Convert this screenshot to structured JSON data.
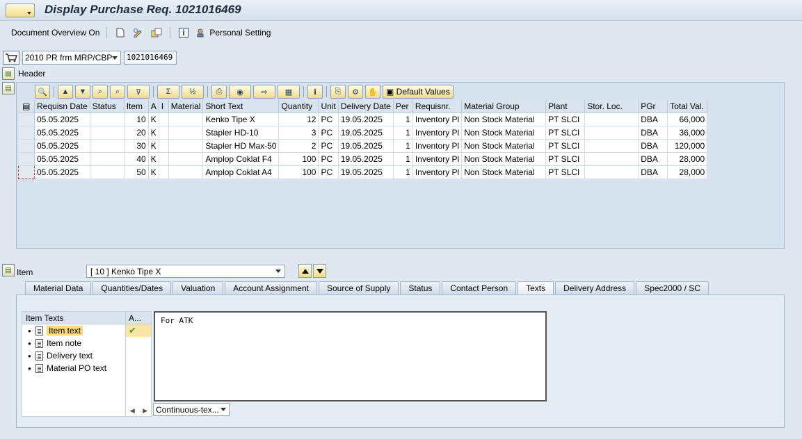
{
  "window": {
    "title": "Display Purchase Req. 1021016469"
  },
  "toolbar": {
    "doc_overview": "Document Overview On",
    "personal_setting": "Personal Setting"
  },
  "document": {
    "type": "2010 PR frm MRP/CBP",
    "number": "1021016469"
  },
  "header": {
    "label": "Header"
  },
  "grid": {
    "default_values": "Default Values",
    "columns": [
      "Requisn Date",
      "Status",
      "Item",
      "A",
      "I",
      "Material",
      "Short Text",
      "Quantity",
      "Unit",
      "Delivery Date",
      "Per",
      "Requisnr.",
      "Material Group",
      "Plant",
      "Stor. Loc.",
      "PGr",
      "Total Val."
    ],
    "rows": [
      [
        "05.05.2025",
        "",
        "10",
        "K",
        "",
        "",
        "Kenko Tipe X",
        "12",
        "PC",
        "19.05.2025",
        "1",
        "Inventory Pl",
        "Non Stock Material",
        "PT SLCI",
        "",
        "DBA",
        "66,000"
      ],
      [
        "05.05.2025",
        "",
        "20",
        "K",
        "",
        "",
        "Stapler HD-10",
        "3",
        "PC",
        "19.05.2025",
        "1",
        "Inventory Pl",
        "Non Stock Material",
        "PT SLCI",
        "",
        "DBA",
        "36,000"
      ],
      [
        "05.05.2025",
        "",
        "30",
        "K",
        "",
        "",
        "Stapler HD Max-50",
        "2",
        "PC",
        "19.05.2025",
        "1",
        "Inventory Pl",
        "Non Stock Material",
        "PT SLCI",
        "",
        "DBA",
        "120,000"
      ],
      [
        "05.05.2025",
        "",
        "40",
        "K",
        "",
        "",
        "Amplop Coklat F4",
        "100",
        "PC",
        "19.05.2025",
        "1",
        "Inventory Pl",
        "Non Stock Material",
        "PT SLCI",
        "",
        "DBA",
        "28,000"
      ],
      [
        "05.05.2025",
        "",
        "50",
        "K",
        "",
        "",
        "Amplop Coklat A4",
        "100",
        "PC",
        "19.05.2025",
        "1",
        "Inventory Pl",
        "Non Stock Material",
        "PT SLCI",
        "",
        "DBA",
        "28,000"
      ]
    ]
  },
  "item": {
    "label": "Item",
    "selected": "[ 10 ] Kenko Tipe X"
  },
  "tabs": [
    "Material Data",
    "Quantities/Dates",
    "Valuation",
    "Account Assignment",
    "Source of Supply",
    "Status",
    "Contact Person",
    "Texts",
    "Delivery Address",
    "Spec2000 / SC"
  ],
  "texts": {
    "tree_header": "Item Texts",
    "active_header": "A...",
    "items": [
      "Item text",
      "Item note",
      "Delivery text",
      "Material PO text"
    ],
    "content": "For ATK",
    "mode": "Continuous-tex..."
  },
  "colors": {
    "background": "#dfe8f1",
    "selection": "#fbd979",
    "button": "#f1dc8c"
  }
}
